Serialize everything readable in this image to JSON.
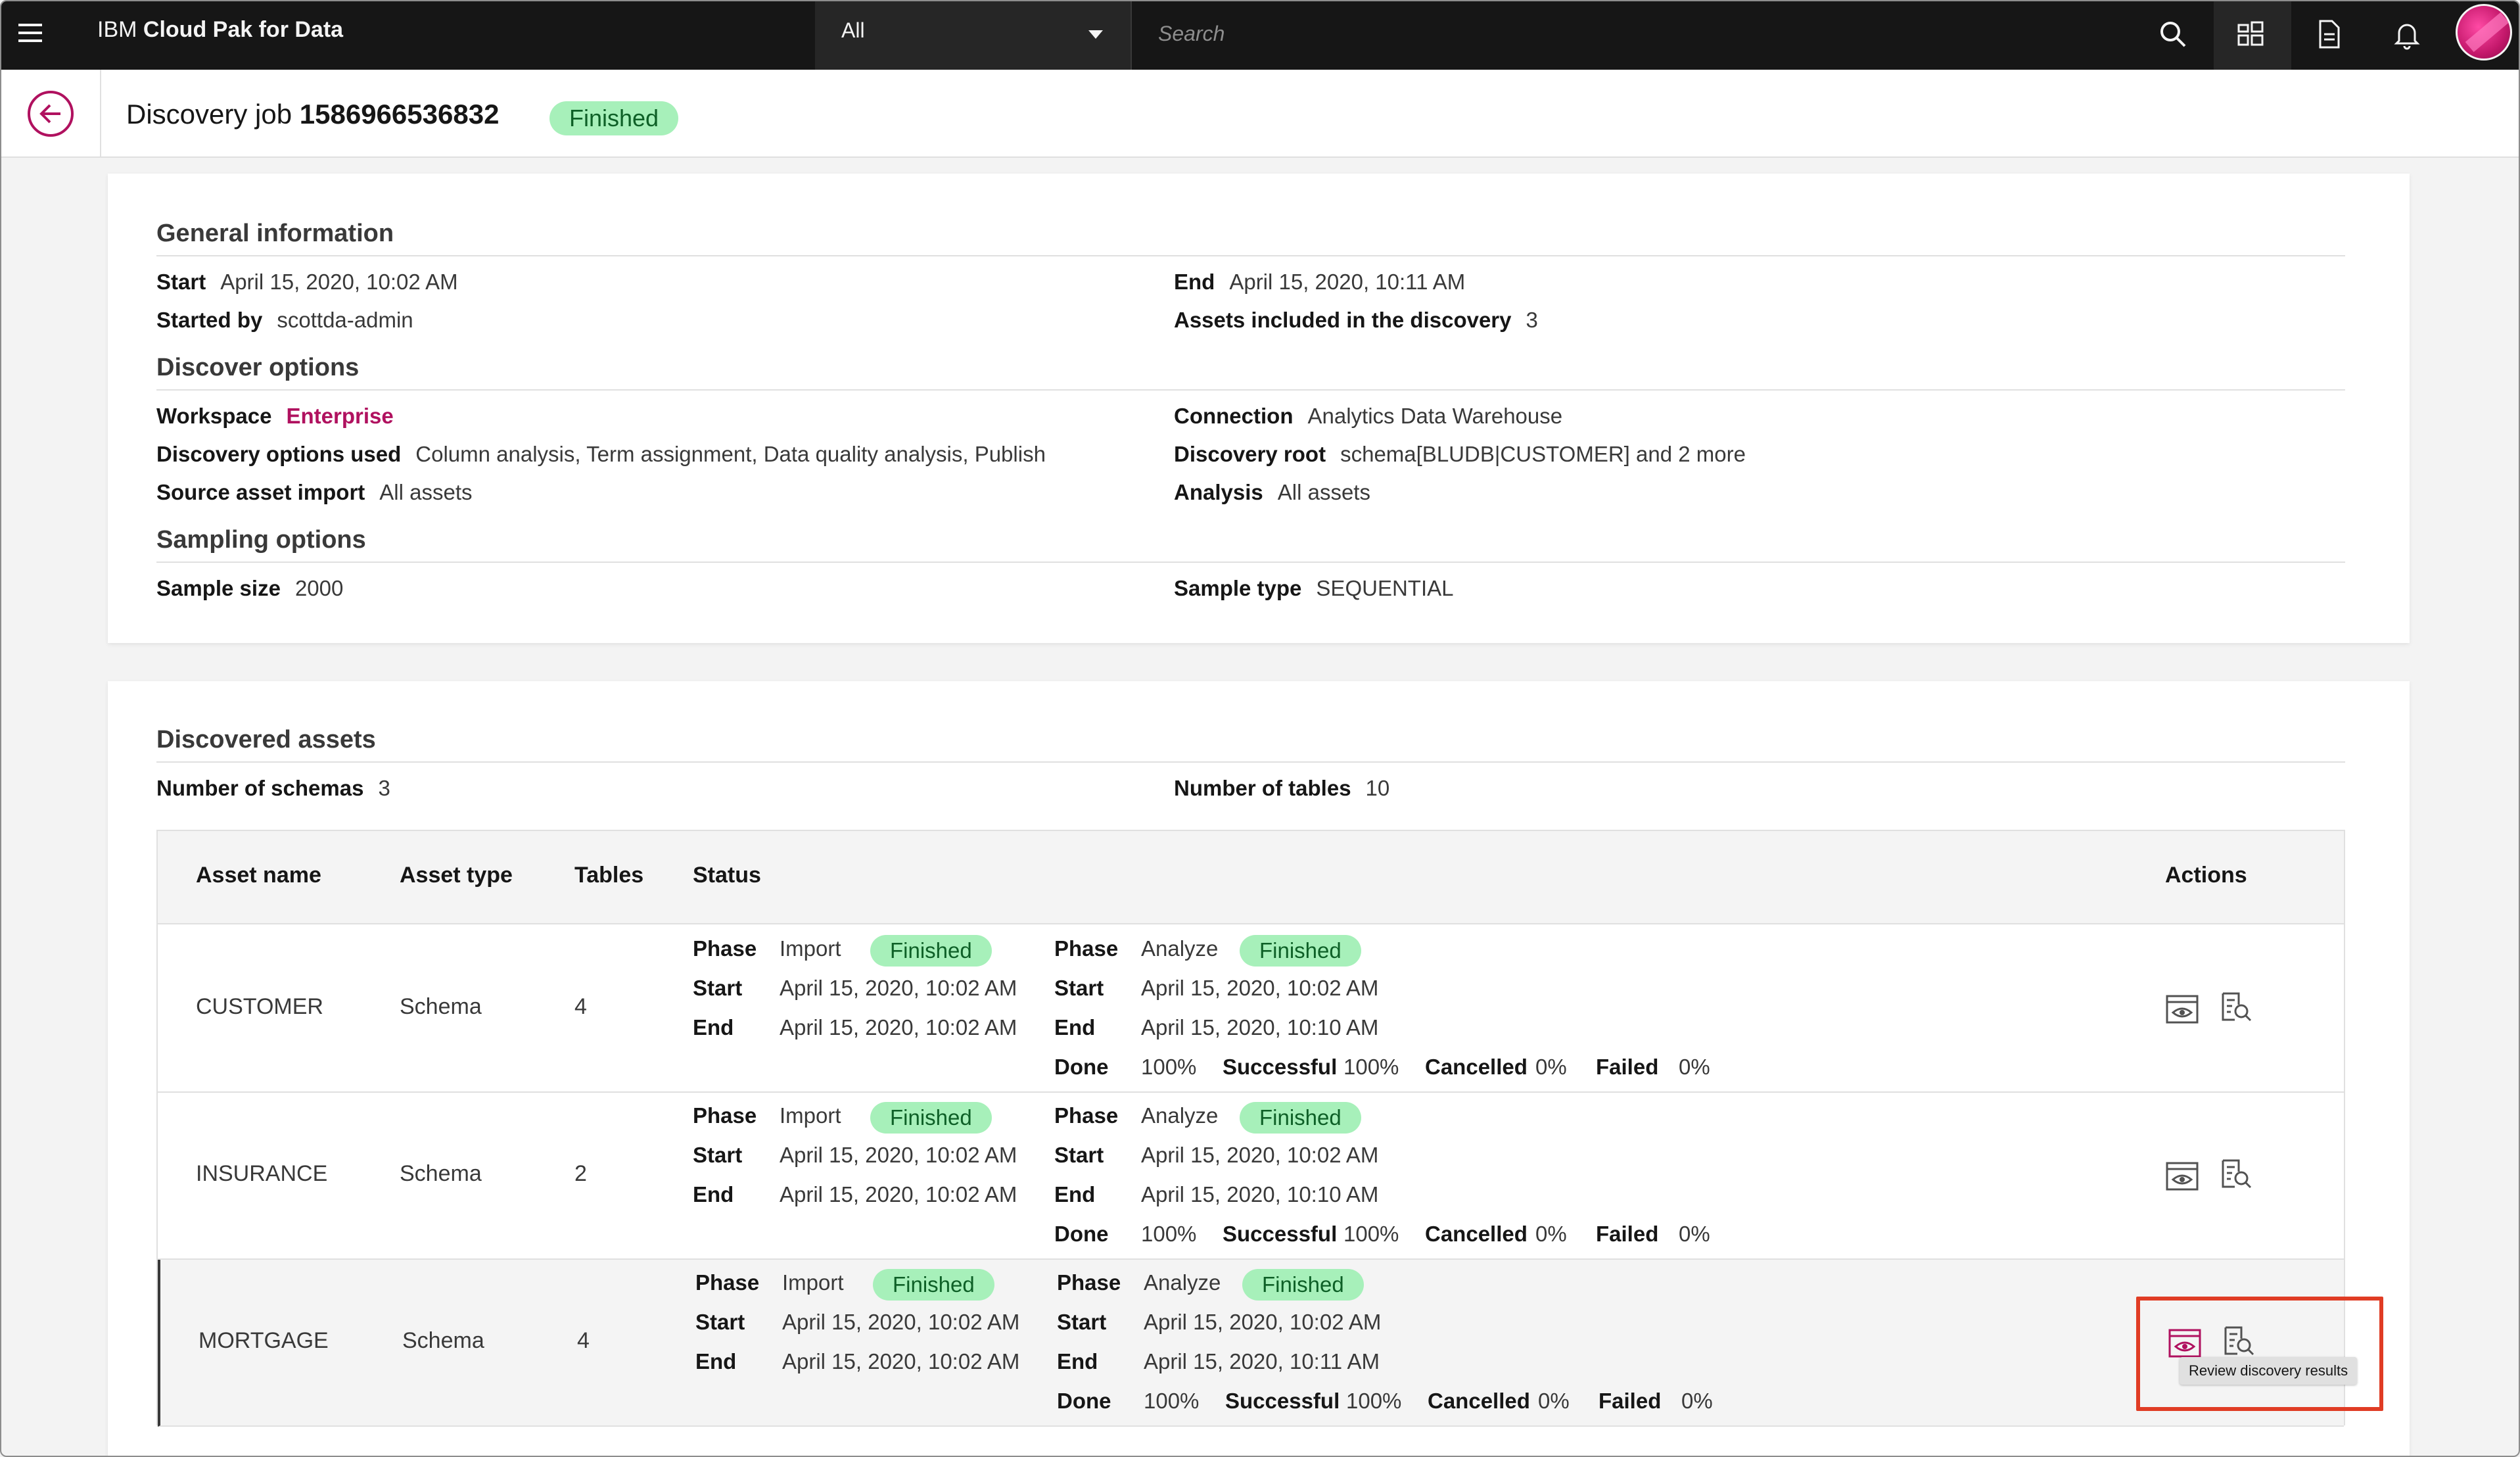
{
  "topbar": {
    "brand_prefix": "IBM ",
    "brand_name": "Cloud Pak for Data",
    "scope_value": "All",
    "search_placeholder": "Search"
  },
  "header": {
    "title_prefix": "Discovery job ",
    "job_id": "1586966536832",
    "status": "Finished"
  },
  "general": {
    "title": "General information",
    "start_label": "Start",
    "start_value": "April 15, 2020, 10:02 AM",
    "started_by_label": "Started by",
    "started_by_value": "scottda-admin",
    "end_label": "End",
    "end_value": "April 15, 2020, 10:11 AM",
    "assets_label": "Assets included in the discovery",
    "assets_value": "3"
  },
  "discover": {
    "title": "Discover options",
    "workspace_label": "Workspace",
    "workspace_value": "Enterprise",
    "options_label": "Discovery options used",
    "options_value": "Column analysis, Term assignment, Data quality analysis, Publish",
    "source_label": "Source asset import",
    "source_value": "All assets",
    "connection_label": "Connection",
    "connection_value": "Analytics Data Warehouse",
    "root_label": "Discovery root",
    "root_value": "schema[BLUDB|CUSTOMER] and 2 more",
    "analysis_label": "Analysis",
    "analysis_value": "All assets"
  },
  "sampling": {
    "title": "Sampling options",
    "size_label": "Sample size",
    "size_value": "2000",
    "type_label": "Sample type",
    "type_value": "SEQUENTIAL"
  },
  "discovered": {
    "title": "Discovered assets",
    "schemas_label": "Number of schemas",
    "schemas_value": "3",
    "tables_label": "Number of tables",
    "tables_value": "10"
  },
  "table": {
    "headers": {
      "asset_name": "Asset name",
      "asset_type": "Asset type",
      "tables": "Tables",
      "status": "Status",
      "actions": "Actions"
    },
    "labels": {
      "phase": "Phase",
      "start": "Start",
      "end": "End",
      "done": "Done",
      "successful": "Successful",
      "cancelled": "Cancelled",
      "failed": "Failed",
      "import": "Import",
      "analyze": "Analyze",
      "finished": "Finished"
    },
    "rows": [
      {
        "name": "CUSTOMER",
        "type": "Schema",
        "tables": "4",
        "import_start": "April 15, 2020, 10:02 AM",
        "import_end": "April 15, 2020, 10:02 AM",
        "analyze_start": "April 15, 2020, 10:02 AM",
        "analyze_end": "April 15, 2020, 10:10 AM",
        "done": "100%",
        "successful": "100%",
        "cancelled": "0%",
        "failed": "0%"
      },
      {
        "name": "INSURANCE",
        "type": "Schema",
        "tables": "2",
        "import_start": "April 15, 2020, 10:02 AM",
        "import_end": "April 15, 2020, 10:02 AM",
        "analyze_start": "April 15, 2020, 10:02 AM",
        "analyze_end": "April 15, 2020, 10:10 AM",
        "done": "100%",
        "successful": "100%",
        "cancelled": "0%",
        "failed": "0%"
      },
      {
        "name": "MORTGAGE",
        "type": "Schema",
        "tables": "4",
        "import_start": "April 15, 2020, 10:02 AM",
        "import_end": "April 15, 2020, 10:02 AM",
        "analyze_start": "April 15, 2020, 10:02 AM",
        "analyze_end": "April 15, 2020, 10:11 AM",
        "done": "100%",
        "successful": "100%",
        "cancelled": "0%",
        "failed": "0%"
      }
    ],
    "tooltip": "Review discovery results"
  },
  "colors": {
    "accent": "#b0115f",
    "status_bg": "#a7f0ba",
    "status_fg": "#0e6027",
    "highlight": "#e03c24"
  }
}
